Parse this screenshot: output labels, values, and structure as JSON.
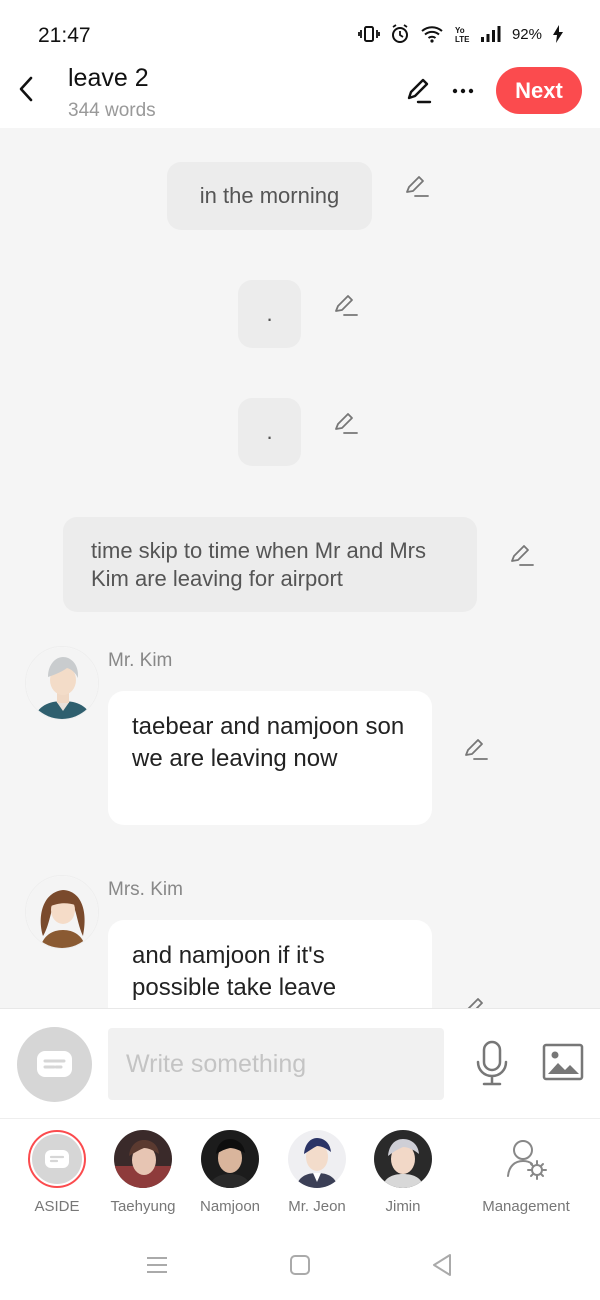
{
  "status_bar": {
    "time": "21:47",
    "battery": "92%",
    "icons": [
      "vibrate-icon",
      "alarm-icon",
      "wifi-icon",
      "volte-icon",
      "signal-icon",
      "battery-charging-icon"
    ]
  },
  "header": {
    "title": "leave 2",
    "word_count": "344 words",
    "next_label": "Next",
    "accent_color": "#fb4b4e"
  },
  "messages": [
    {
      "type": "narration",
      "text": "in the morning"
    },
    {
      "type": "narration",
      "text": "."
    },
    {
      "type": "narration",
      "text": "."
    },
    {
      "type": "narration",
      "text": "time skip to time when Mr and Mrs Kim are leaving for airport"
    },
    {
      "type": "dialogue",
      "speaker": "Mr. Kim",
      "text": "taebear and namjoon son we are leaving now"
    },
    {
      "type": "dialogue",
      "speaker": "Mrs. Kim",
      "text": "and namjoon if it's possible take leave"
    }
  ],
  "input": {
    "placeholder": "Write something"
  },
  "characters": [
    {
      "label": "ASIDE",
      "selected": true
    },
    {
      "label": "Taehyung"
    },
    {
      "label": "Namjoon"
    },
    {
      "label": "Mr. Jeon"
    },
    {
      "label": "Jimin"
    },
    {
      "label": "Management"
    }
  ]
}
